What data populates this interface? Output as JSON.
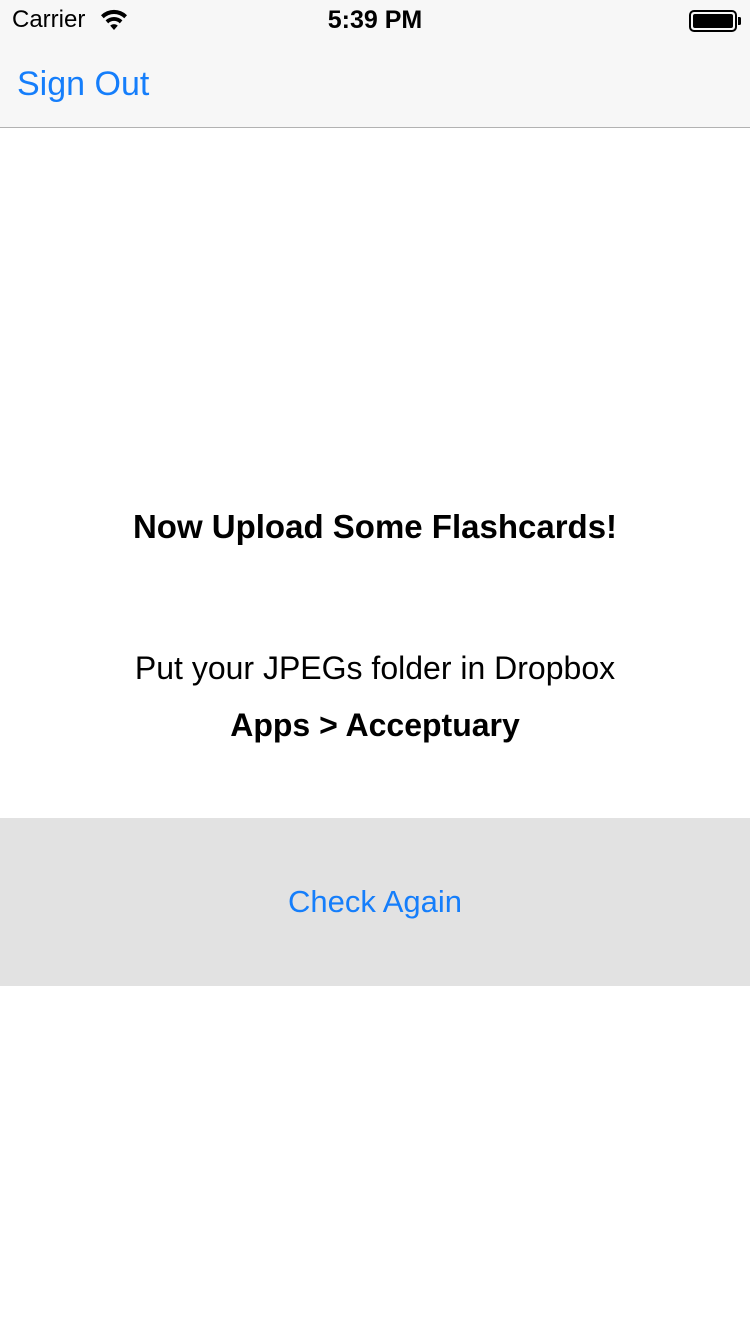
{
  "status_bar": {
    "carrier": "Carrier",
    "time": "5:39 PM",
    "wifi_icon": "wifi-icon",
    "battery_icon": "battery-full-icon"
  },
  "nav": {
    "sign_out_label": "Sign Out"
  },
  "main": {
    "heading": "Now Upload Some Flashcards!",
    "instruction": "Put your JPEGs folder in Dropbox",
    "path": "Apps > Acceptuary",
    "check_again_label": "Check Again"
  },
  "colors": {
    "accent": "#157efb",
    "chrome_background": "#f7f7f7",
    "button_band_background": "#e2e2e2",
    "text": "#000000"
  }
}
